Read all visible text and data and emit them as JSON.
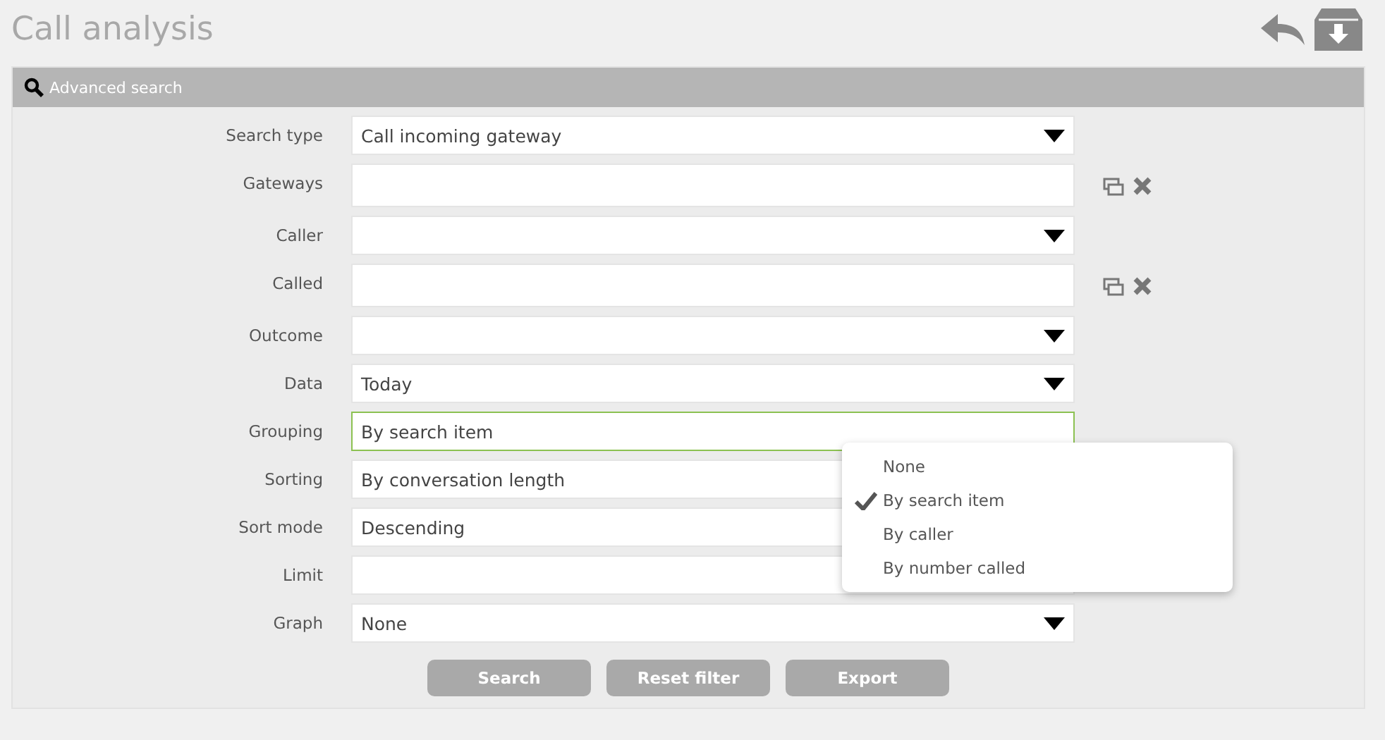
{
  "page": {
    "title": "Call analysis"
  },
  "panel": {
    "title": "Advanced search"
  },
  "fields": [
    {
      "label": "Search type",
      "kind": "select",
      "value": "Call incoming gateway",
      "focused": false
    },
    {
      "label": "Gateways",
      "kind": "multi",
      "focused": false
    },
    {
      "label": "Caller",
      "kind": "select",
      "focused": false
    },
    {
      "label": "Called",
      "kind": "multi",
      "focused": false
    },
    {
      "label": "Outcome",
      "kind": "select",
      "focused": false
    },
    {
      "label": "Data",
      "kind": "select",
      "value": "Today",
      "focused": false
    },
    {
      "label": "Grouping",
      "kind": "text",
      "value": "By search item",
      "focused": true
    },
    {
      "label": "Sorting",
      "kind": "text",
      "value": "By conversation length",
      "focused": false
    },
    {
      "label": "Sort mode",
      "kind": "text",
      "value": "Descending",
      "focused": false
    },
    {
      "label": "Limit",
      "kind": "text",
      "focused": false
    },
    {
      "label": "Graph",
      "kind": "select",
      "value": "None",
      "focused": false
    }
  ],
  "dropdown": {
    "options": [
      {
        "label": "None",
        "selected": false
      },
      {
        "label": "By search item",
        "selected": true
      },
      {
        "label": "By caller",
        "selected": false
      },
      {
        "label": "By number called",
        "selected": false
      }
    ]
  },
  "buttons": [
    "Search",
    "Reset filter",
    "Export"
  ]
}
